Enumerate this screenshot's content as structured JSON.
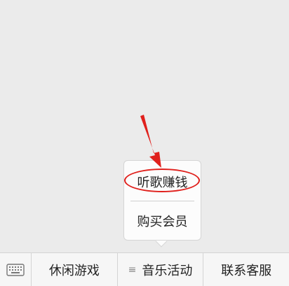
{
  "popup_menu": {
    "items": [
      {
        "label": "听歌赚钱"
      },
      {
        "label": "购买会员"
      }
    ]
  },
  "menu_bar": {
    "keyboard_icon": "keyboard-icon",
    "tabs": [
      {
        "label": "休闲游戏"
      },
      {
        "label": "音乐活动",
        "icon": "list-icon"
      },
      {
        "label": "联系客服"
      }
    ]
  },
  "colors": {
    "annotation": "#e0201c",
    "background": "#ebebeb",
    "menu_bar": "#f6f6f6"
  }
}
